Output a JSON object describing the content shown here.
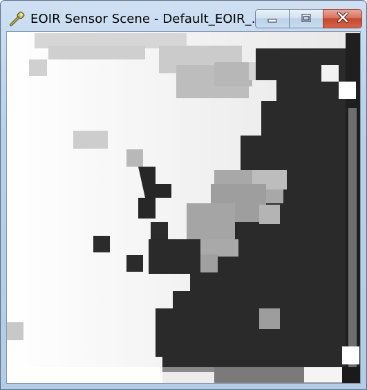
{
  "window": {
    "title": "EOIR Sensor Scene - Default_EOIR_...",
    "icon": "sensor-scene-icon"
  },
  "controls": {
    "minimize": "minimize-icon",
    "maximize": "maximize-icon",
    "close": "close-icon"
  },
  "scene": {
    "content": "pixelated grayscale infrared sensor image"
  }
}
